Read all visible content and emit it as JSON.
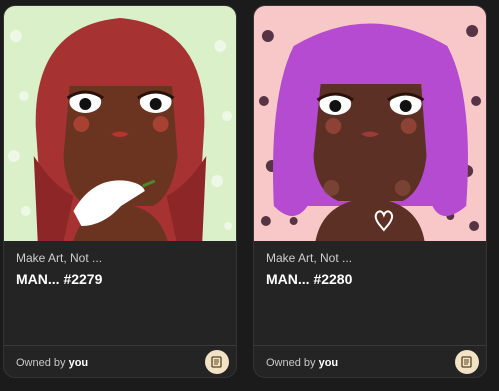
{
  "cards": [
    {
      "collection": "Make Art, Not ...",
      "name": "MAN... #2279",
      "owned_prefix": "Owned by",
      "owner": "you",
      "action_icon": "scroll-icon"
    },
    {
      "collection": "Make Art, Not ...",
      "name": "MAN... #2280",
      "owned_prefix": "Owned by",
      "owner": "you",
      "action_icon": "scroll-icon"
    }
  ],
  "colors": {
    "card_bg": "#242424",
    "art1_bg": "#d9f0c8",
    "art1_hair": "#a73232",
    "art2_bg": "#f8c8c8",
    "art2_hair": "#b44bd0",
    "skin": "#6b3420"
  }
}
